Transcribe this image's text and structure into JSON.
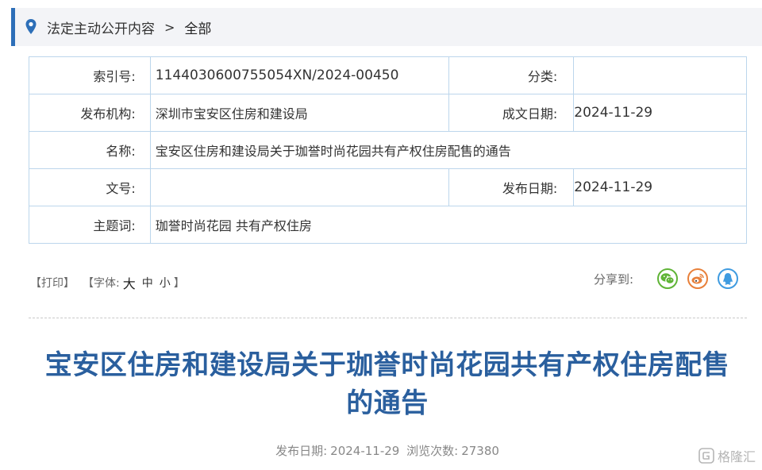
{
  "breadcrumb": {
    "section": "法定主动公开内容",
    "separator": ">",
    "current": "全部"
  },
  "info": {
    "index_label": "索引号:",
    "index_value": "1144030600755054XN/2024-00450",
    "category_label": "分类:",
    "category_value": "",
    "publisher_label": "发布机构:",
    "publisher_value": "深圳市宝安区住房和建设局",
    "written_date_label": "成文日期:",
    "written_date_value": "2024-11-29",
    "name_label": "名称:",
    "name_value": "宝安区住房和建设局关于珈誉时尚花园共有产权住房配售的通告",
    "doc_no_label": "文号:",
    "doc_no_value": "",
    "publish_date_label": "发布日期:",
    "publish_date_value": "2024-11-29",
    "keywords_label": "主题词:",
    "keywords_value": "珈誉时尚花园 共有产权住房"
  },
  "tools": {
    "print": "【打印】",
    "font_prefix": "【字体:",
    "font_large": "大",
    "font_medium": "中",
    "font_small": "小",
    "font_suffix": "】",
    "share_label": "分享到:"
  },
  "share_icons": [
    "wechat-icon",
    "weibo-icon",
    "qq-icon"
  ],
  "article": {
    "title_line1": "宝安区住房和建设局关于珈誉时尚花园共有产权住房配售",
    "title_line2": "的通告",
    "publish_date_label": "发布日期:",
    "publish_date": "2024-11-29",
    "views_label": "浏览次数:",
    "views": "27380"
  },
  "watermark": {
    "text": "格隆汇"
  },
  "colors": {
    "accent": "#2d6fb8",
    "title": "#2a5f9e",
    "table_border": "#bcd6ec",
    "breadcrumb_bg": "#f3f4f7"
  }
}
